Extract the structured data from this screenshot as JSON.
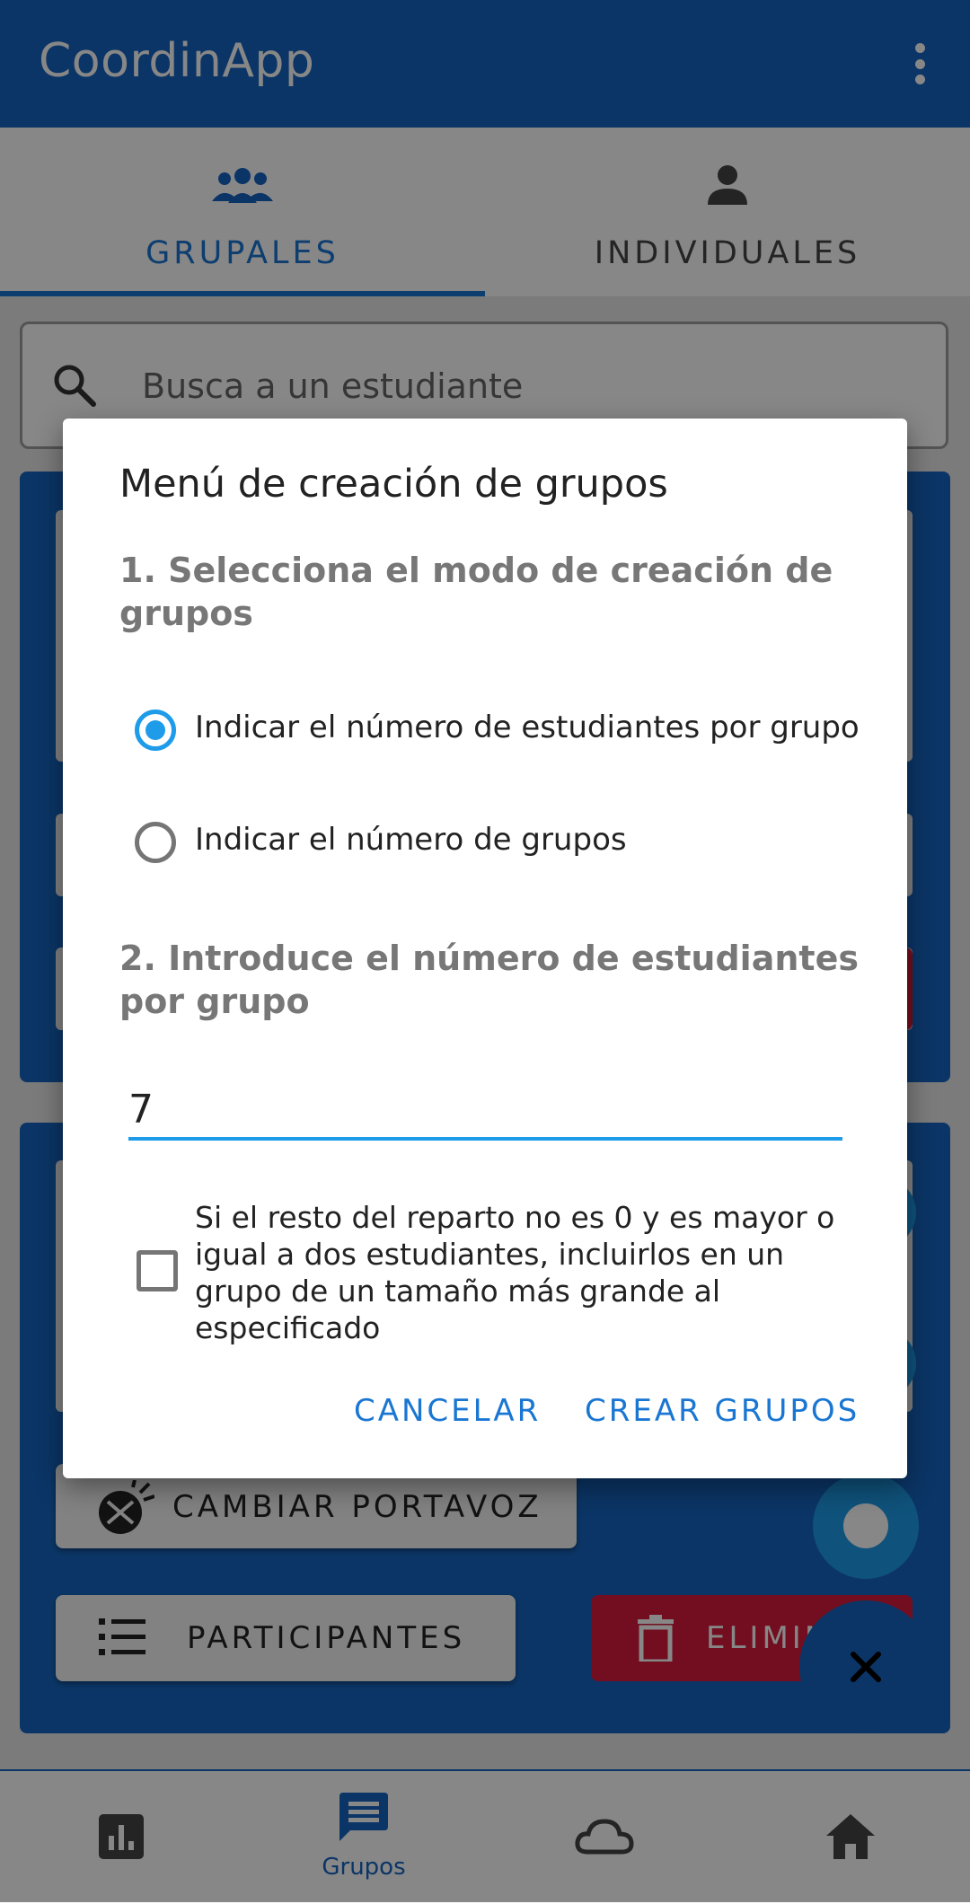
{
  "app": {
    "title": "CoordinApp"
  },
  "tabs": [
    {
      "label": "GRUPALES",
      "icon": "group-icon",
      "active": true
    },
    {
      "label": "INDIVIDUALES",
      "icon": "person-icon",
      "active": false
    }
  ],
  "search": {
    "placeholder": "Busca a un estudiante"
  },
  "background": {
    "cambiar_portavoz": "CAMBIAR PORTAVOZ",
    "participantes": "PARTICIPANTES",
    "eliminar": "ELIMIN"
  },
  "bottom_nav": [
    {
      "icon": "chart-icon",
      "label": ""
    },
    {
      "icon": "chat-icon",
      "label": "Grupos",
      "active": true
    },
    {
      "icon": "cloud-icon",
      "label": ""
    },
    {
      "icon": "home-icon",
      "label": ""
    }
  ],
  "dialog": {
    "title": "Menú de creación de grupos",
    "section1": "1. Selecciona el modo de creación de grupos",
    "options": [
      {
        "label": "Indicar el número de estudiantes por grupo",
        "selected": true
      },
      {
        "label": "Indicar el número de grupos",
        "selected": false
      }
    ],
    "section2": "2. Introduce el número de estudiantes por grupo",
    "number_value": "7",
    "checkbox_label": "Si el resto del reparto no es 0 y es mayor o igual a dos estudiantes, incluirlos en un grupo de un tamaño más grande al especificado",
    "checkbox_checked": false,
    "cancel": "CANCELAR",
    "create": "CREAR GRUPOS"
  },
  "colors": {
    "primary": "#1565c0",
    "accent": "#1e9be9",
    "danger": "#d81b3c"
  }
}
